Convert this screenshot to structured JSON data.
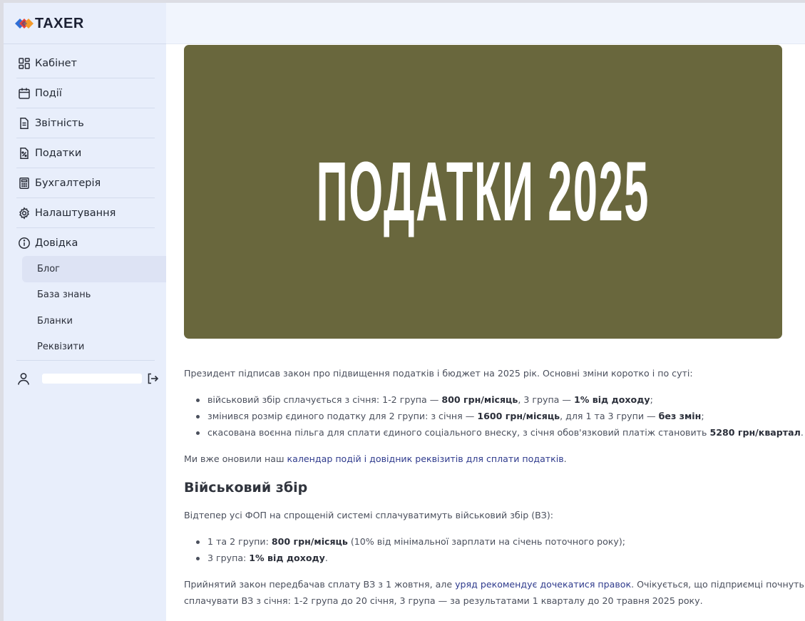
{
  "app": {
    "logo_text": "TAXER"
  },
  "sidebar": {
    "items": [
      {
        "label": "Кабінет",
        "icon": "dashboard-icon"
      },
      {
        "label": "Події",
        "icon": "calendar-icon"
      },
      {
        "label": "Звітність",
        "icon": "document-icon"
      },
      {
        "label": "Податки",
        "icon": "percent-icon"
      },
      {
        "label": "Бухгалтерія",
        "icon": "calculator-icon"
      },
      {
        "label": "Налаштування",
        "icon": "gear-icon"
      },
      {
        "label": "Довідка",
        "icon": "info-icon"
      }
    ],
    "sub_items": [
      {
        "label": "Блог",
        "active": true
      },
      {
        "label": "База знань"
      },
      {
        "label": "Бланки"
      },
      {
        "label": "Реквізити"
      }
    ],
    "user_icon": "user-icon",
    "logout_icon": "logout-icon"
  },
  "article": {
    "hero_title": "ПОДАТКИ 2025",
    "hero_color": "#69673d",
    "intro": "Президент підписав закон про підвищення податків і бюджет на 2025 рік. Основні зміни коротко і по суті:",
    "bullets": [
      {
        "a": "військовий збір сплачується з січня: 1-2 група — ",
        "b1": "800 грн/місяць",
        "c": ", 3 група — ",
        "b2": "1% від доходу",
        "d": ";"
      },
      {
        "a": "змінився розмір єдиного податку для 2 групи: з січня — ",
        "b1": "1600 грн/місяць",
        "c": ", для 1 та 3 групи — ",
        "b2": "без змін",
        "d": ";"
      },
      {
        "a": "скасована воєнна пільга для сплати єдиного соціального внеску, з січня обов'язковий платіж становить ",
        "b1": "5280 грн/квартал",
        "d": "."
      }
    ],
    "note_prefix": "Ми вже оновили наш ",
    "note_link": "календар подій і довідник реквізитів для сплати податків",
    "note_suffix": ".",
    "section_title": "Військовий збір",
    "section_lead": "Відтепер усі ФОП на спрощеній системі сплачуватимуть військовий збір (ВЗ):",
    "section_bullets": [
      {
        "a": "1 та 2 групи: ",
        "b": "800 грн/місяць",
        "c": " (10% від мінімальної зарплати на січень поточного року);"
      },
      {
        "a": "3 група: ",
        "b": "1% від доходу",
        "c": "."
      }
    ],
    "last_prefix": "Прийнятий закон передбачав сплату ВЗ з 1 жовтня, але ",
    "last_link": "уряд рекомендує дочекатися правок",
    "last_suffix": ". Очікується, що підприємці почнуть",
    "last_line2": "сплачувати ВЗ з січня: 1-2 група до 20 січня, 3 група — за результатами 1 кварталу до 20 травня 2025 року."
  }
}
